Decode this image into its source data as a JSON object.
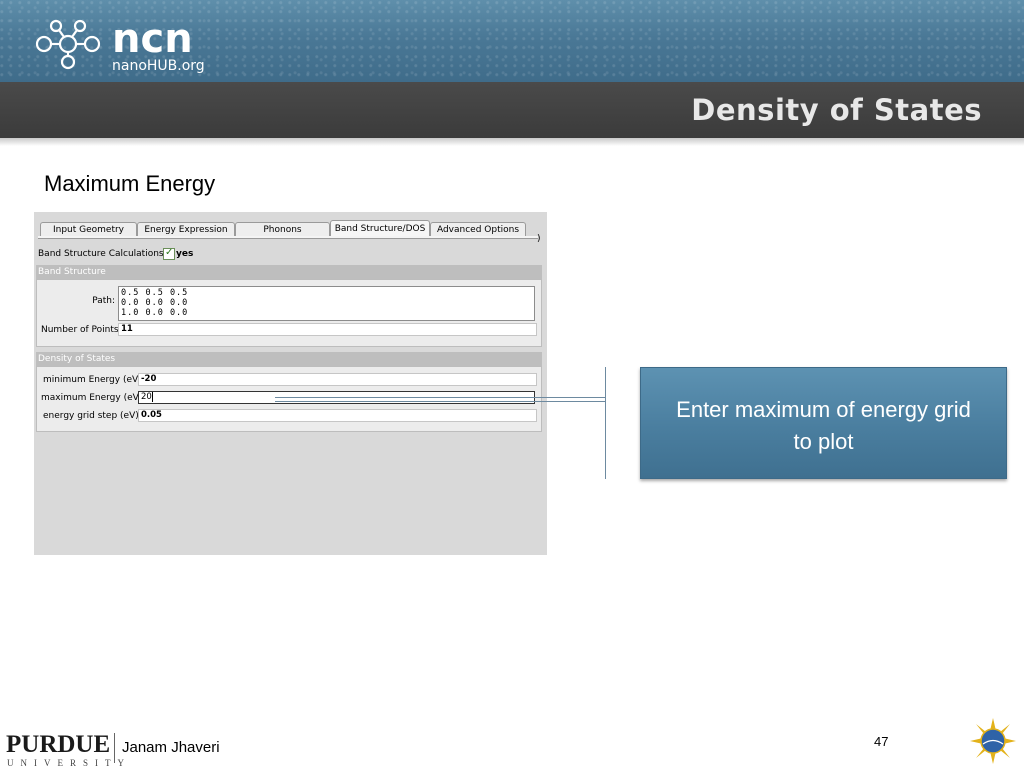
{
  "header": {
    "brand": "ncn",
    "brand_sub": "nanoHUB.org",
    "title": "Density of States"
  },
  "slide_heading": "Maximum Energy",
  "app": {
    "tabs": [
      {
        "label": "Input Geometry",
        "active": false
      },
      {
        "label": "Energy Expression",
        "active": false
      },
      {
        "label": "Phonons",
        "active": false
      },
      {
        "label": "Band Structure/DOS",
        "active": true
      },
      {
        "label": "Advanced Options",
        "active": false
      }
    ],
    "tab_end": ")",
    "band_calc_label": "Band Structure Calculations:",
    "band_calc_value": "yes",
    "band_calc_checked": true,
    "band_group": {
      "title": "Band Structure",
      "path_label": "Path:",
      "path_lines": [
        "0.5 0.5 0.5",
        "0.0 0.0 0.0",
        "1.0 0.0 0.0"
      ],
      "points_label": "Number of Points:",
      "points_value": "11"
    },
    "dos_group": {
      "title": "Density of States",
      "min_label": "minimum Energy (eV):",
      "min_value": "-20",
      "max_label": "maximum Energy (eV):",
      "max_value": "20",
      "step_label": "energy grid step (eV):",
      "step_value": "0.05"
    }
  },
  "callout": {
    "line1": "Enter maximum of energy grid",
    "line2": "to plot"
  },
  "footer": {
    "logo_main": "PURDUE",
    "logo_sub": "UNIVERSITY",
    "author": "Janam Jhaveri",
    "page_number": "47"
  },
  "colors": {
    "header_blue": "#4a7896",
    "header_band": "#3b3b3b",
    "callout_blue": "#4a7e9f"
  }
}
